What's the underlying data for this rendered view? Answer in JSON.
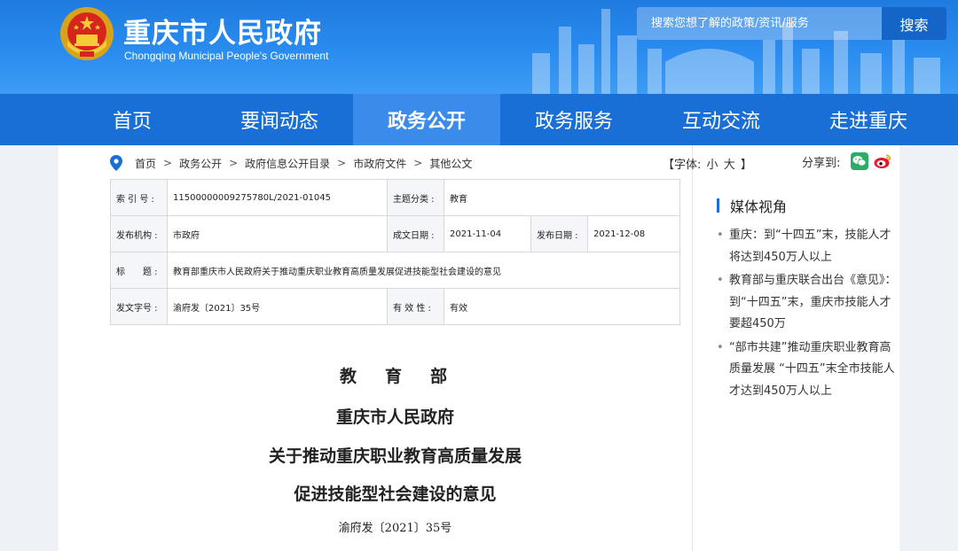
{
  "header": {
    "title": "重庆市人民政府",
    "subtitle": "Chongqing Municipal People's Government",
    "search_placeholder": "搜索您想了解的政策/资讯/服务",
    "search_button": "搜索"
  },
  "nav": [
    {
      "label": "首页",
      "active": false
    },
    {
      "label": "要闻动态",
      "active": false
    },
    {
      "label": "政务公开",
      "active": true
    },
    {
      "label": "政务服务",
      "active": false
    },
    {
      "label": "互动交流",
      "active": false
    },
    {
      "label": "走进重庆",
      "active": false
    }
  ],
  "breadcrumb": [
    "首页",
    "政务公开",
    "政府信息公开目录",
    "市政府文件",
    "其他公文"
  ],
  "breadcrumb_sep": ">",
  "font_size": {
    "prefix": "【字体:",
    "small": "小",
    "large": "大",
    "suffix": "】"
  },
  "share": {
    "label": "分享到:",
    "icons": [
      "wechat-icon",
      "weibo-icon"
    ]
  },
  "info": {
    "index_label": "索 引 号 :",
    "index_value": "11500000009275780L/2021-01045",
    "topic_label": "主题分类 :",
    "topic_value": "教育",
    "org_label": "发布机构 :",
    "org_value": "市政府",
    "date_label": "成文日期 :",
    "date_value": "2021-11-04",
    "pub_label": "发布日期 :",
    "pub_value": "2021-12-08",
    "title_label": "标　　题 :",
    "title_value": "教育部重庆市人民政府关于推动重庆职业教育高质量发展促进技能型社会建设的意见",
    "docno_label": "发文字号 :",
    "docno_value": "渝府发〔2021〕35号",
    "valid_label": "有 效 性 :",
    "valid_value": "有效"
  },
  "document": {
    "issuer1": "教育部",
    "issuer2": "重庆市人民政府",
    "title_line1": "关于推动重庆职业教育高质量发展",
    "title_line2": "促进技能型社会建设的意见",
    "number": "渝府发〔2021〕35号"
  },
  "sidebar": {
    "title": "媒体视角",
    "items": [
      "重庆：到“十四五”末，技能人才将达到450万人以上",
      "教育部与重庆联合出台《意见》：到“十四五”末，重庆市技能人才要超450万",
      "“部市共建”推动重庆职业教育高质量发展 “十四五”末全市技能人才达到450万人以上"
    ]
  },
  "colors": {
    "header_blue": "#2a8cf0",
    "nav_blue": "#1a6fd6",
    "nav_active": "#3a8bea",
    "search_button": "#1565c8",
    "wechat_green": "#2aae67",
    "weibo_red": "#e6162d"
  }
}
